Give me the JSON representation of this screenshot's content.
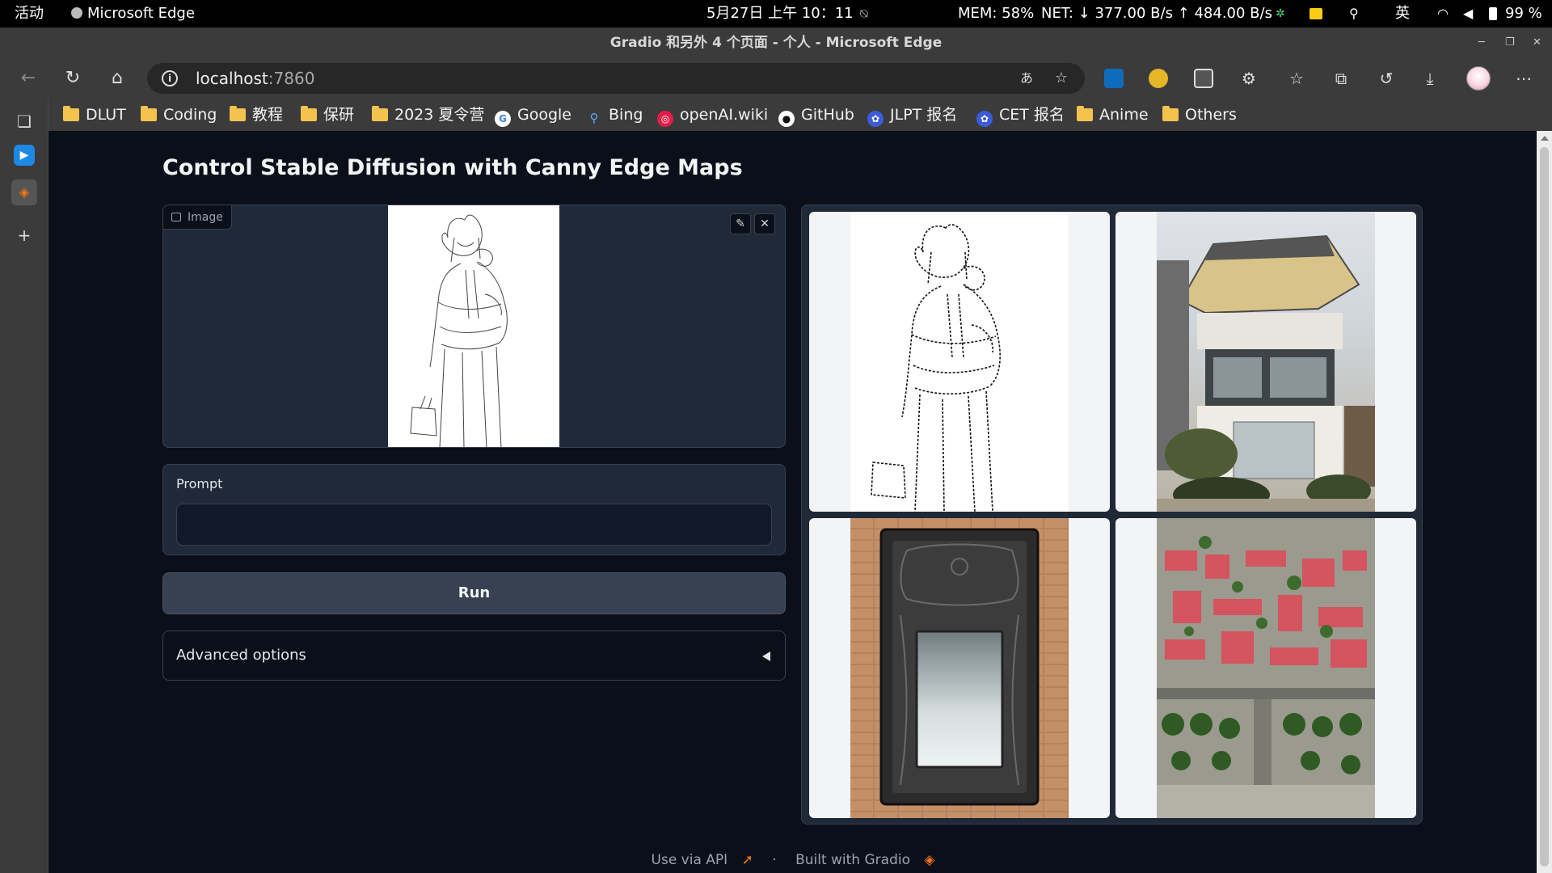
{
  "topbar": {
    "activities": "活动",
    "app_name": "Microsoft Edge",
    "clock": "5月27日  上午 10：11",
    "mem": "MEM: 58%",
    "net": "NET: ↓ 377.00 B/s ↑ 484.00 B/s",
    "ime": "英",
    "battery": "99 %"
  },
  "window": {
    "title": "Gradio 和另外 4 个页面 - 个人 - Microsoft Edge"
  },
  "address": {
    "host": "localhost",
    "port": ":7860"
  },
  "favorites": [
    {
      "label": "DLUT",
      "icon": "folder-icon"
    },
    {
      "label": "Coding",
      "icon": "folder-icon"
    },
    {
      "label": "教程",
      "icon": "folder-icon"
    },
    {
      "label": "保研",
      "icon": "folder-icon"
    },
    {
      "label": "2023 夏令营",
      "icon": "folder-icon"
    },
    {
      "label": "Google",
      "icon": "google-icon"
    },
    {
      "label": "Bing",
      "icon": "bing-search-icon"
    },
    {
      "label": "openAI.wiki",
      "icon": "openai-wiki-icon"
    },
    {
      "label": "GitHub",
      "icon": "github-icon"
    },
    {
      "label": "JLPT 报名",
      "icon": "jlpt-icon"
    },
    {
      "label": "CET 报名",
      "icon": "cet-icon"
    },
    {
      "label": "Anime",
      "icon": "folder-icon"
    },
    {
      "label": "Others",
      "icon": "folder-icon"
    }
  ],
  "app": {
    "title": "Control Stable Diffusion with Canny Edge Maps",
    "image_label": "Image",
    "prompt_label": "Prompt",
    "prompt_value": "",
    "run_label": "Run",
    "advanced_label": "Advanced options",
    "gallery": [
      "canny-edge-map",
      "modern-house",
      "carved-mirror",
      "aerial-city"
    ]
  },
  "footer": {
    "api": "Use via API",
    "separator": "·",
    "built": "Built with Gradio"
  },
  "colors": {
    "page_bg": "#0b0f19",
    "panel_bg": "#1f2937",
    "border": "#374151",
    "button_bg": "#374151",
    "chrome_bg": "#3b3b3b",
    "folder": "#f3c24f",
    "gradio_orange": "#f97316"
  }
}
